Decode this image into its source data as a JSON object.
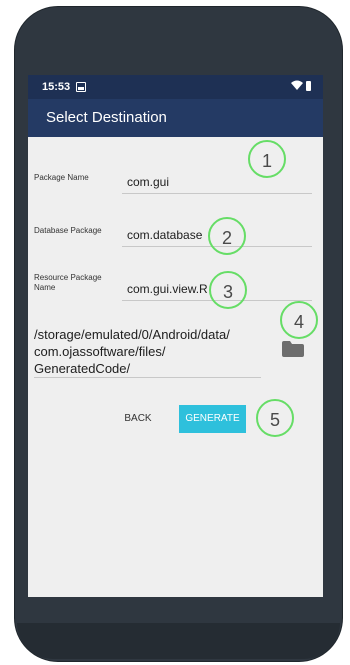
{
  "status_bar": {
    "time": "15:53"
  },
  "app_bar": {
    "title": "Select Destination"
  },
  "fields": {
    "package_name": {
      "label": "Package Name",
      "value": "com.gui"
    },
    "database_package": {
      "label": "Database Package",
      "value": "com.database"
    },
    "resource_package_name": {
      "label": "Resource Package Name",
      "value": "com.gui.view.R"
    }
  },
  "output_path": {
    "lines": [
      "/storage/emulated/0/Android/data/",
      "com.ojassoftware/files/",
      "GeneratedCode/"
    ]
  },
  "buttons": {
    "back": "BACK",
    "generate": "GENERATE"
  },
  "annotations": [
    "1",
    "2",
    "3",
    "4",
    "5"
  ],
  "colors": {
    "app_bar": "#243a64",
    "status_bar": "#1e3054",
    "generate_button": "#2ec0dc",
    "annotation_circle": "#66dd66"
  },
  "icons": {
    "gallery": "image-icon",
    "wifi": "wifi-icon",
    "battery": "battery-icon",
    "folder": "folder-icon"
  }
}
